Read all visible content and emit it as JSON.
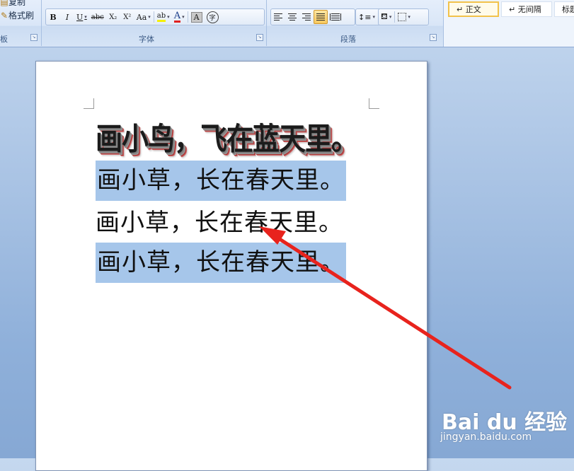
{
  "ribbon": {
    "clipboard": {
      "copy_label": "复制",
      "format_painter_label": "格式刷",
      "group_label": "板"
    },
    "font": {
      "group_label": "字体",
      "bold": "B",
      "italic": "I",
      "underline": "U",
      "strikethrough": "abc",
      "subscript": "X₂",
      "superscript": "X²",
      "change_case": "Aa",
      "highlight": "ab",
      "font_color": "A",
      "char_shading": "A",
      "enclose_char": "字",
      "font_color_hex": "#e02020",
      "highlight_hex": "#f5f000"
    },
    "paragraph": {
      "group_label": "段落",
      "active_alignment": "justify"
    },
    "styles": {
      "items": [
        "↵ 正文",
        "↵ 无间隔",
        "标题"
      ]
    }
  },
  "document": {
    "wordart_line": "画小鸟，飞在蓝天里。",
    "lines": [
      {
        "text": "画小草，长在春天里。",
        "selected": true
      },
      {
        "text": "画小草，长在春天里。",
        "selected": false
      },
      {
        "text": "画小草，长在春天里。",
        "selected": true
      }
    ]
  },
  "annotation": {
    "arrow_color": "#e8231d"
  },
  "watermark": {
    "logo_text": "Bai du 经验",
    "url": "jingyan.baidu.com"
  }
}
